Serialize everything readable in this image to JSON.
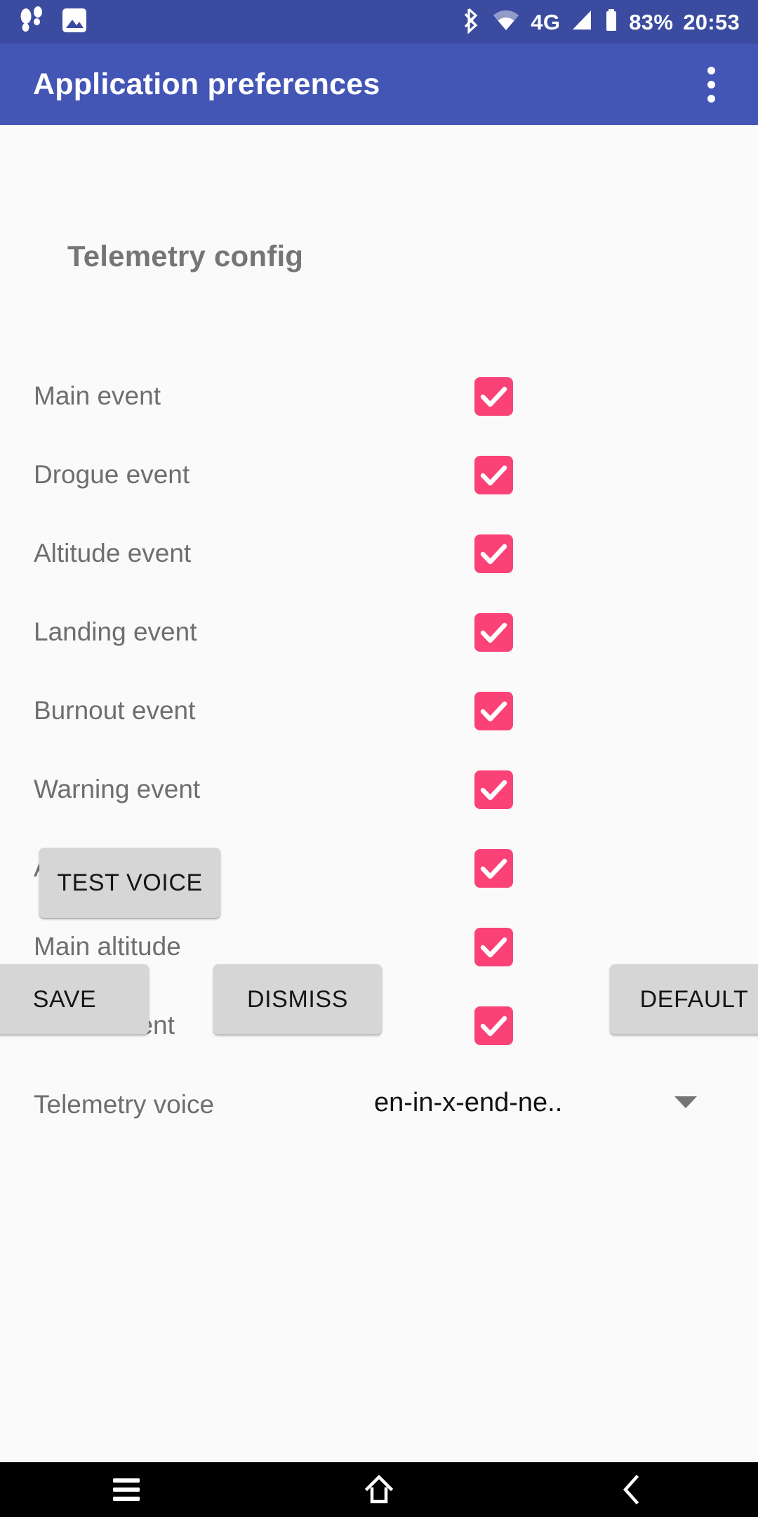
{
  "status_bar": {
    "background": "#3A4BA0",
    "left_icons": [
      {
        "name": "footsteps-icon",
        "label": "footsteps"
      },
      {
        "name": "photo-icon",
        "label": "photo"
      }
    ],
    "right_icons": [
      {
        "name": "bluetooth-icon",
        "label": "bluetooth"
      },
      {
        "name": "wifi-icon",
        "label": "wifi"
      },
      {
        "name": "signal-icon",
        "label": "signal"
      },
      {
        "name": "battery-icon",
        "label": "battery"
      }
    ],
    "network_type": "4G",
    "battery_percent": "83%",
    "clock": "20:53"
  },
  "app_bar": {
    "title": "Application preferences",
    "background": "#4356B6",
    "overflow_menu_name": "more-options"
  },
  "main": {
    "section_title": "Telemetry config",
    "checkbox_color": "#FB4277",
    "preferences": [
      {
        "label": "Main event",
        "checked": true
      },
      {
        "label": "Drogue event",
        "checked": true
      },
      {
        "label": "Altitude event",
        "checked": true
      },
      {
        "label": "Landing event",
        "checked": true
      },
      {
        "label": "Burnout event",
        "checked": true
      },
      {
        "label": "Warning event",
        "checked": true
      },
      {
        "label": "Apogee altitude",
        "checked": true
      },
      {
        "label": "Main altitude",
        "checked": true
      },
      {
        "label": "Lift off event",
        "checked": true
      }
    ],
    "voice_row": {
      "label": "Telemetry voice",
      "selected_value": "en-in-x-end-ne.."
    },
    "test_voice_label": "TEST VOICE"
  },
  "footer": {
    "save_label": "SAVE",
    "dismiss_label": "DISMISS",
    "default_label": "DEFAULT"
  },
  "nav_bar": {
    "background": "#000000",
    "recents_name": "recents",
    "home_name": "home",
    "back_name": "back"
  }
}
